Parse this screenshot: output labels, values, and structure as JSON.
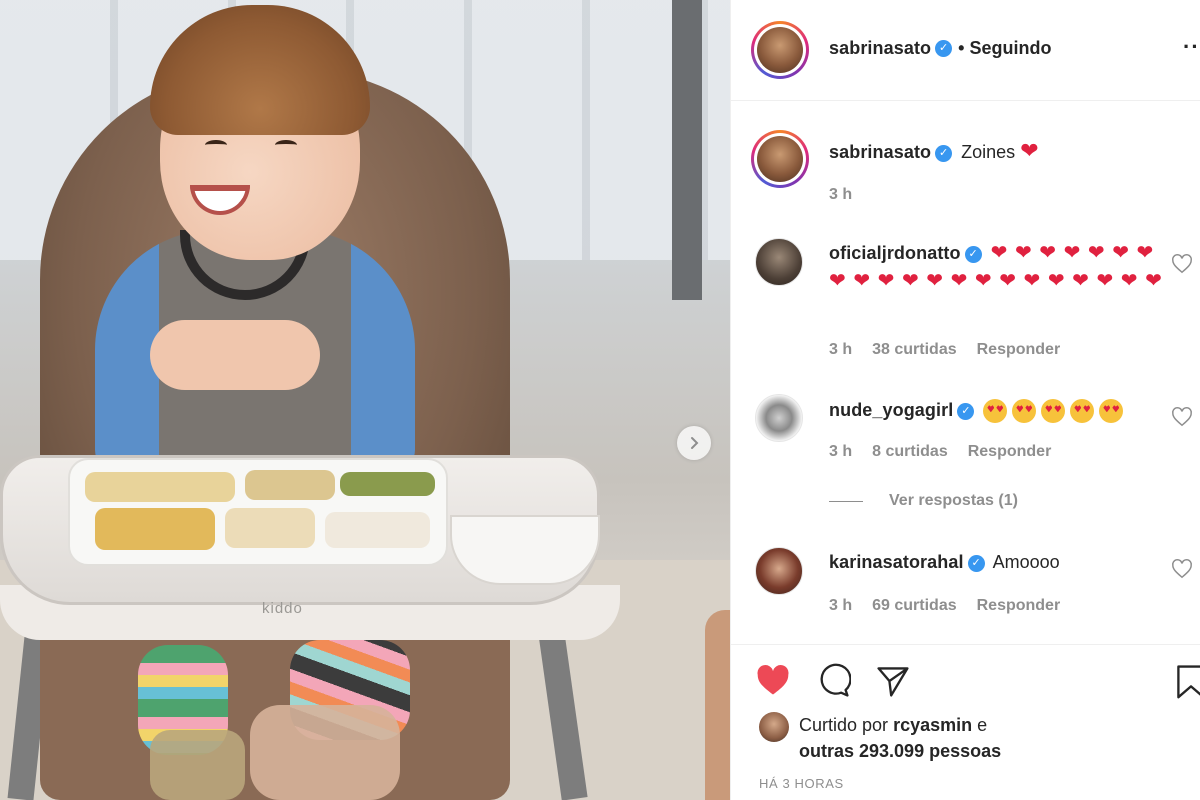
{
  "post": {
    "author": "sabrinasato",
    "follow_status": "• Seguindo",
    "more_label": "···",
    "photo_logo_text": "kiddo",
    "caption": {
      "username": "sabrinasato",
      "text": "Zoines",
      "emoji": "❤",
      "time": "3 h"
    }
  },
  "comments": [
    {
      "username": "oficialjrdonatto",
      "text": "❤ ❤ ❤ ❤ ❤ ❤ ❤ ❤ ❤ ❤ ❤ ❤ ❤ ❤ ❤ ❤ ❤ ❤ ❤ ❤ ❤",
      "time": "3 h",
      "likes": "38 curtidas",
      "reply": "Responder"
    },
    {
      "username": "nude_yogagirl",
      "text": "",
      "emoji_count": 5,
      "time": "3 h",
      "likes": "8 curtidas",
      "reply": "Responder",
      "view_replies": "Ver respostas (1)"
    },
    {
      "username": "karinasatorahal",
      "text": "Amoooo",
      "time": "3 h",
      "likes": "69 curtidas",
      "reply": "Responder"
    }
  ],
  "liked_by": {
    "prefix": "Curtido por",
    "user": "rcyasmin",
    "suffix": "e",
    "others": "outras 293.099 pessoas"
  },
  "timestamp": "HÁ 3 HORAS",
  "icons": {
    "like": "heart-filled-icon",
    "comment": "comment-bubble-icon",
    "share": "paper-plane-icon",
    "save": "bookmark-icon",
    "next": "chevron-right-icon",
    "verified": "verified-badge-icon"
  },
  "colors": {
    "like_red": "#ed4956",
    "verified_blue": "#3897f0",
    "text": "#262626",
    "muted": "#8e8e8e"
  }
}
